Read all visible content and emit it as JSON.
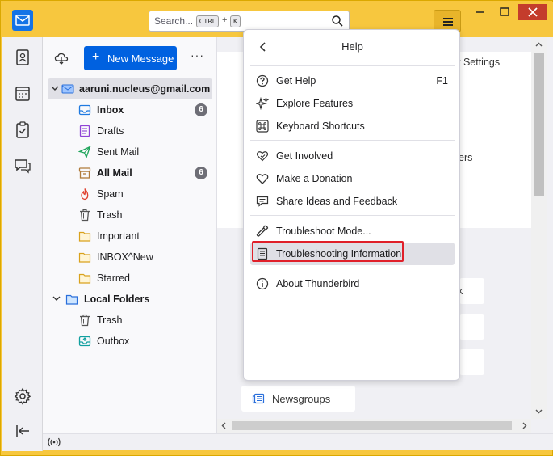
{
  "titlebar": {
    "search_placeholder": "Search...",
    "kbd_ctrl": "CTRL",
    "kbd_plus": "+",
    "kbd_key": "K"
  },
  "folder_pane": {
    "new_message_label": "New Message",
    "more_label": "···",
    "account": {
      "name": "aaruni.nucleus@gmail.com",
      "folders": [
        {
          "label": "Inbox",
          "bold": true,
          "badge": "6"
        },
        {
          "label": "Drafts"
        },
        {
          "label": "Sent Mail"
        },
        {
          "label": "All Mail",
          "bold": true,
          "badge": "6"
        },
        {
          "label": "Spam"
        },
        {
          "label": "Trash"
        },
        {
          "label": "Important"
        },
        {
          "label": "INBOX^New"
        },
        {
          "label": "Starred"
        }
      ]
    },
    "local": {
      "name": "Local Folders",
      "folders": [
        {
          "label": "Trash"
        },
        {
          "label": "Outbox"
        }
      ]
    }
  },
  "main": {
    "account_settings_partial": "t Settings",
    "ers_partial": "ers",
    "k_partial": "k",
    "newsgroups_label": "Newsgroups"
  },
  "help_menu": {
    "title": "Help",
    "items": [
      {
        "label": "Get Help",
        "shortcut": "F1",
        "icon": "question-icon"
      },
      {
        "label": "Explore Features",
        "icon": "sparkle-icon"
      },
      {
        "label": "Keyboard Shortcuts",
        "icon": "command-icon"
      },
      {
        "label": "Get Involved",
        "icon": "heart-hands-icon"
      },
      {
        "label": "Make a Donation",
        "icon": "heart-icon"
      },
      {
        "label": "Share Ideas and Feedback",
        "icon": "feedback-icon"
      },
      {
        "label": "Troubleshoot Mode...",
        "icon": "wrench-icon"
      },
      {
        "label": "Troubleshooting Information",
        "icon": "document-icon",
        "highlighted": true
      },
      {
        "label": "About Thunderbird",
        "icon": "info-icon"
      }
    ]
  },
  "colors": {
    "titlebar": "#f7c73e",
    "accent": "#0061e0",
    "highlight_border": "#e0202a"
  }
}
